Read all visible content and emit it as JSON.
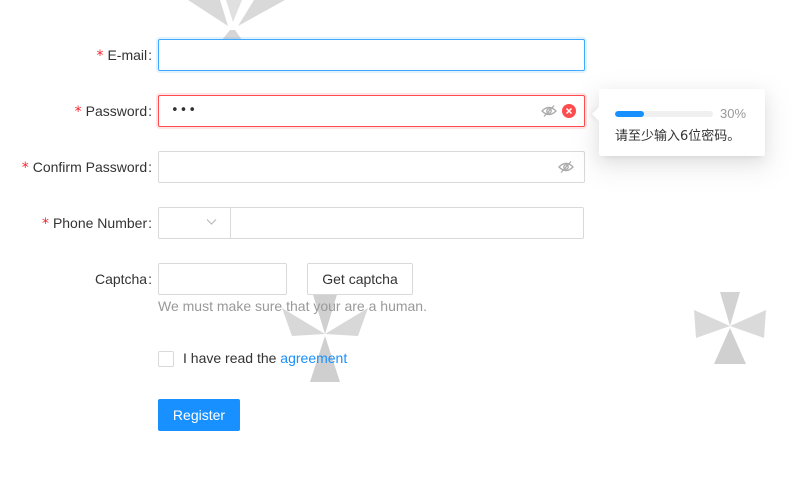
{
  "form": {
    "email": {
      "label": "E-mail",
      "required": true,
      "value": ""
    },
    "password": {
      "label": "Password",
      "required": true,
      "masked_value": "•••",
      "clear_icon": "close-circle-icon",
      "eye_icon": "eye-invisible-icon"
    },
    "confirm_password": {
      "label": "Confirm Password",
      "required": true,
      "value": "",
      "eye_icon": "eye-invisible-icon"
    },
    "phone": {
      "label": "Phone Number",
      "required": true,
      "prefix_value": "",
      "value": "",
      "dropdown_icon": "chevron-down-icon"
    },
    "captcha": {
      "label": "Captcha",
      "required": false,
      "value": "",
      "button_label": "Get captcha",
      "hint": "We must make sure that your are a human."
    },
    "agreement": {
      "checked": false,
      "text": "I have read the",
      "link_text": "agreement"
    },
    "submit_label": "Register",
    "required_mark": "*",
    "colon": ":"
  },
  "password_strength": {
    "percent": 30,
    "percent_text": "30%",
    "message": "请至少输入6位密码。"
  },
  "colors": {
    "primary": "#1890ff",
    "error": "#ff4d4f",
    "required": "#f5222d"
  }
}
